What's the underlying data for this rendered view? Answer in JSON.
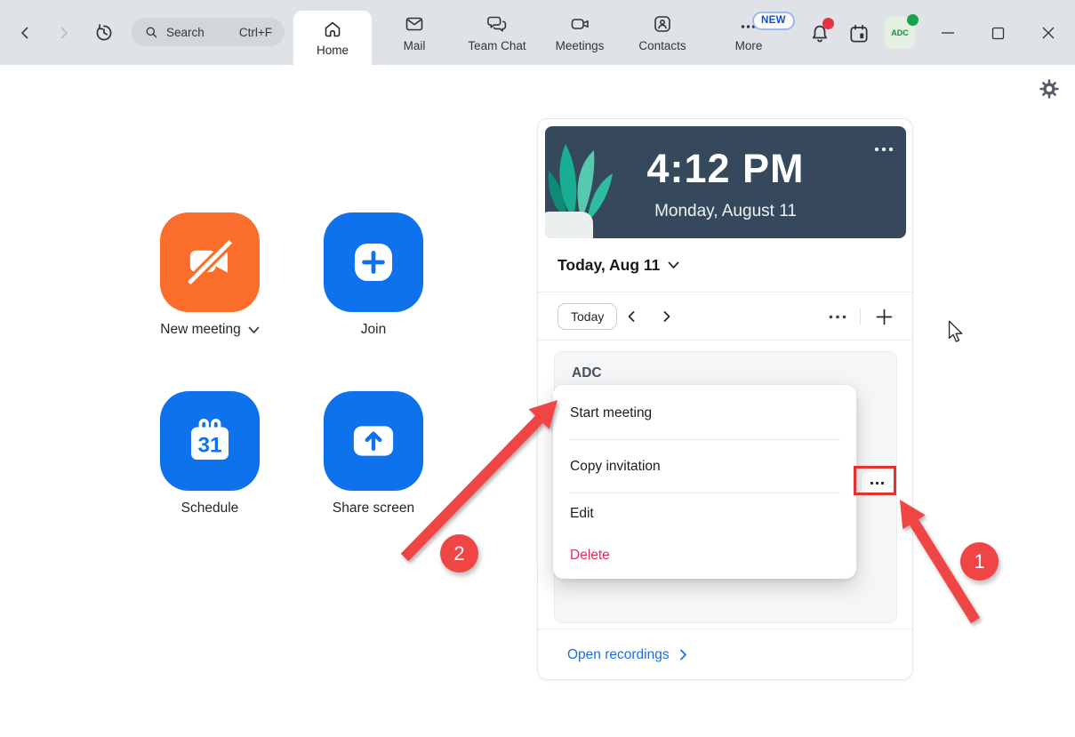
{
  "colors": {
    "accent_blue": "#0E72ED",
    "brand_orange": "#FB6D2A",
    "clock_bg": "#35485C",
    "danger_red": "#DF2D5A",
    "link_blue": "#1A6FE8",
    "annotation_red": "#EF4545"
  },
  "topbar": {
    "search": {
      "placeholder": "Search",
      "shortcut": "Ctrl+F"
    },
    "tabs": {
      "home": "Home",
      "mail": "Mail",
      "team_chat": "Team Chat",
      "meetings": "Meetings",
      "contacts": "Contacts",
      "more": "More",
      "more_badge": "NEW"
    },
    "avatar_label": "ADC"
  },
  "quick_actions": {
    "new_meeting": "New meeting",
    "join": "Join",
    "schedule": "Schedule",
    "share_screen": "Share screen",
    "schedule_day": "31"
  },
  "panel": {
    "clock": {
      "time": "4:12 PM",
      "date": "Monday, August 11"
    },
    "date_header": "Today, Aug 11",
    "toolbar": {
      "today": "Today"
    },
    "meeting": {
      "title": "ADC"
    },
    "menu": {
      "start": "Start meeting",
      "copy": "Copy invitation",
      "edit": "Edit",
      "delete": "Delete"
    },
    "footer_link": "Open recordings"
  },
  "annotations": {
    "step1": "1",
    "step2": "2"
  }
}
